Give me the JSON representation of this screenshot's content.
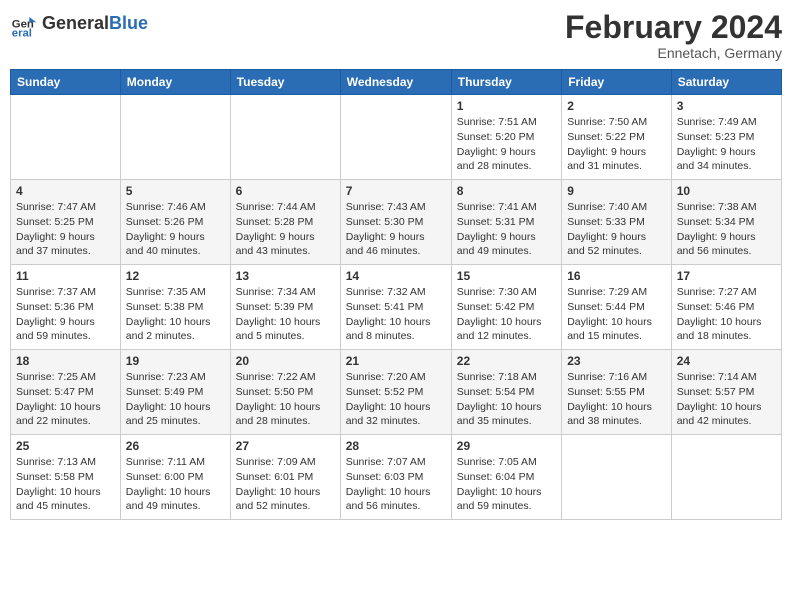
{
  "header": {
    "logo_general": "General",
    "logo_blue": "Blue",
    "month_title": "February 2024",
    "location": "Ennetach, Germany"
  },
  "columns": [
    "Sunday",
    "Monday",
    "Tuesday",
    "Wednesday",
    "Thursday",
    "Friday",
    "Saturday"
  ],
  "weeks": [
    [
      {
        "day": "",
        "info": ""
      },
      {
        "day": "",
        "info": ""
      },
      {
        "day": "",
        "info": ""
      },
      {
        "day": "",
        "info": ""
      },
      {
        "day": "1",
        "info": "Sunrise: 7:51 AM\nSunset: 5:20 PM\nDaylight: 9 hours\nand 28 minutes."
      },
      {
        "day": "2",
        "info": "Sunrise: 7:50 AM\nSunset: 5:22 PM\nDaylight: 9 hours\nand 31 minutes."
      },
      {
        "day": "3",
        "info": "Sunrise: 7:49 AM\nSunset: 5:23 PM\nDaylight: 9 hours\nand 34 minutes."
      }
    ],
    [
      {
        "day": "4",
        "info": "Sunrise: 7:47 AM\nSunset: 5:25 PM\nDaylight: 9 hours\nand 37 minutes."
      },
      {
        "day": "5",
        "info": "Sunrise: 7:46 AM\nSunset: 5:26 PM\nDaylight: 9 hours\nand 40 minutes."
      },
      {
        "day": "6",
        "info": "Sunrise: 7:44 AM\nSunset: 5:28 PM\nDaylight: 9 hours\nand 43 minutes."
      },
      {
        "day": "7",
        "info": "Sunrise: 7:43 AM\nSunset: 5:30 PM\nDaylight: 9 hours\nand 46 minutes."
      },
      {
        "day": "8",
        "info": "Sunrise: 7:41 AM\nSunset: 5:31 PM\nDaylight: 9 hours\nand 49 minutes."
      },
      {
        "day": "9",
        "info": "Sunrise: 7:40 AM\nSunset: 5:33 PM\nDaylight: 9 hours\nand 52 minutes."
      },
      {
        "day": "10",
        "info": "Sunrise: 7:38 AM\nSunset: 5:34 PM\nDaylight: 9 hours\nand 56 minutes."
      }
    ],
    [
      {
        "day": "11",
        "info": "Sunrise: 7:37 AM\nSunset: 5:36 PM\nDaylight: 9 hours\nand 59 minutes."
      },
      {
        "day": "12",
        "info": "Sunrise: 7:35 AM\nSunset: 5:38 PM\nDaylight: 10 hours\nand 2 minutes."
      },
      {
        "day": "13",
        "info": "Sunrise: 7:34 AM\nSunset: 5:39 PM\nDaylight: 10 hours\nand 5 minutes."
      },
      {
        "day": "14",
        "info": "Sunrise: 7:32 AM\nSunset: 5:41 PM\nDaylight: 10 hours\nand 8 minutes."
      },
      {
        "day": "15",
        "info": "Sunrise: 7:30 AM\nSunset: 5:42 PM\nDaylight: 10 hours\nand 12 minutes."
      },
      {
        "day": "16",
        "info": "Sunrise: 7:29 AM\nSunset: 5:44 PM\nDaylight: 10 hours\nand 15 minutes."
      },
      {
        "day": "17",
        "info": "Sunrise: 7:27 AM\nSunset: 5:46 PM\nDaylight: 10 hours\nand 18 minutes."
      }
    ],
    [
      {
        "day": "18",
        "info": "Sunrise: 7:25 AM\nSunset: 5:47 PM\nDaylight: 10 hours\nand 22 minutes."
      },
      {
        "day": "19",
        "info": "Sunrise: 7:23 AM\nSunset: 5:49 PM\nDaylight: 10 hours\nand 25 minutes."
      },
      {
        "day": "20",
        "info": "Sunrise: 7:22 AM\nSunset: 5:50 PM\nDaylight: 10 hours\nand 28 minutes."
      },
      {
        "day": "21",
        "info": "Sunrise: 7:20 AM\nSunset: 5:52 PM\nDaylight: 10 hours\nand 32 minutes."
      },
      {
        "day": "22",
        "info": "Sunrise: 7:18 AM\nSunset: 5:54 PM\nDaylight: 10 hours\nand 35 minutes."
      },
      {
        "day": "23",
        "info": "Sunrise: 7:16 AM\nSunset: 5:55 PM\nDaylight: 10 hours\nand 38 minutes."
      },
      {
        "day": "24",
        "info": "Sunrise: 7:14 AM\nSunset: 5:57 PM\nDaylight: 10 hours\nand 42 minutes."
      }
    ],
    [
      {
        "day": "25",
        "info": "Sunrise: 7:13 AM\nSunset: 5:58 PM\nDaylight: 10 hours\nand 45 minutes."
      },
      {
        "day": "26",
        "info": "Sunrise: 7:11 AM\nSunset: 6:00 PM\nDaylight: 10 hours\nand 49 minutes."
      },
      {
        "day": "27",
        "info": "Sunrise: 7:09 AM\nSunset: 6:01 PM\nDaylight: 10 hours\nand 52 minutes."
      },
      {
        "day": "28",
        "info": "Sunrise: 7:07 AM\nSunset: 6:03 PM\nDaylight: 10 hours\nand 56 minutes."
      },
      {
        "day": "29",
        "info": "Sunrise: 7:05 AM\nSunset: 6:04 PM\nDaylight: 10 hours\nand 59 minutes."
      },
      {
        "day": "",
        "info": ""
      },
      {
        "day": "",
        "info": ""
      }
    ]
  ]
}
